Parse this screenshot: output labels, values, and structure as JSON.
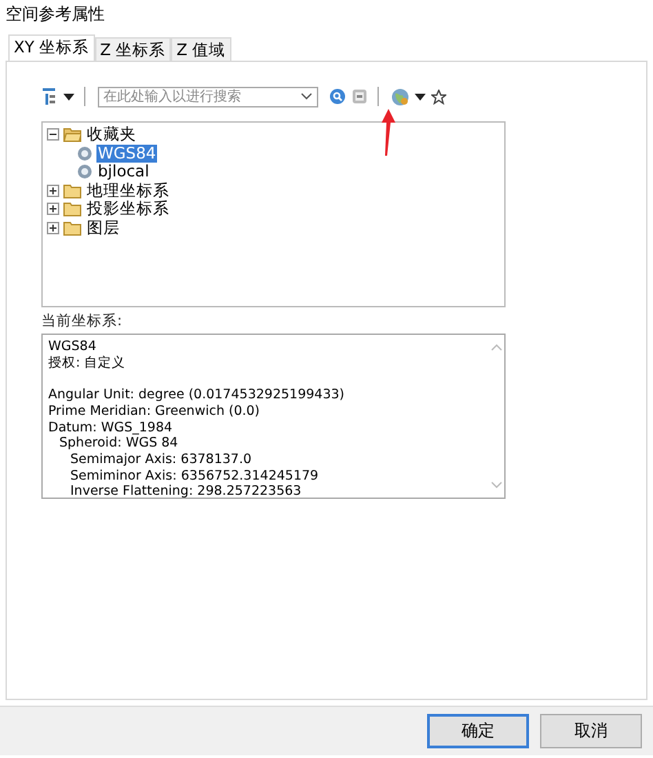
{
  "window": {
    "title": "空间参考属性"
  },
  "tabs": [
    {
      "label": "XY 坐标系",
      "selected": true
    },
    {
      "label": "Z 坐标系",
      "selected": false
    },
    {
      "label": "Z 值域",
      "selected": false
    }
  ],
  "search": {
    "placeholder": "在此处输入以进行搜索"
  },
  "tree": [
    {
      "kind": "folder",
      "label": "收藏夹",
      "expanded": true,
      "selected": false,
      "children": [
        {
          "kind": "crs",
          "label": "WGS84",
          "selected": true
        },
        {
          "kind": "crs",
          "label": "bjlocal",
          "selected": false
        }
      ]
    },
    {
      "kind": "folder",
      "label": "地理坐标系",
      "expanded": false,
      "selected": false
    },
    {
      "kind": "folder",
      "label": "投影坐标系",
      "expanded": false,
      "selected": false
    },
    {
      "kind": "folder",
      "label": "图层",
      "expanded": false,
      "selected": false
    }
  ],
  "current": {
    "label": "当前坐标系:",
    "lines": [
      {
        "text": "WGS84"
      },
      {
        "text": "授权: 自定义"
      },
      {
        "kind": "gap"
      },
      {
        "text": "Angular Unit: degree (0.0174532925199433)"
      },
      {
        "text": "Prime Meridian: Greenwich (0.0)"
      },
      {
        "text": "Datum: WGS_1984",
        "children": [
          {
            "text": "Spheroid: WGS 84",
            "children": [
              {
                "text": "Semimajor Axis: 6378137.0"
              },
              {
                "text": "Semiminor Axis: 6356752.314245179"
              },
              {
                "text": "Inverse Flattening: 298.257223563"
              }
            ]
          }
        ]
      }
    ]
  },
  "buttons": [
    {
      "label": "确定",
      "default": true
    },
    {
      "label": "取消",
      "default": false
    }
  ]
}
